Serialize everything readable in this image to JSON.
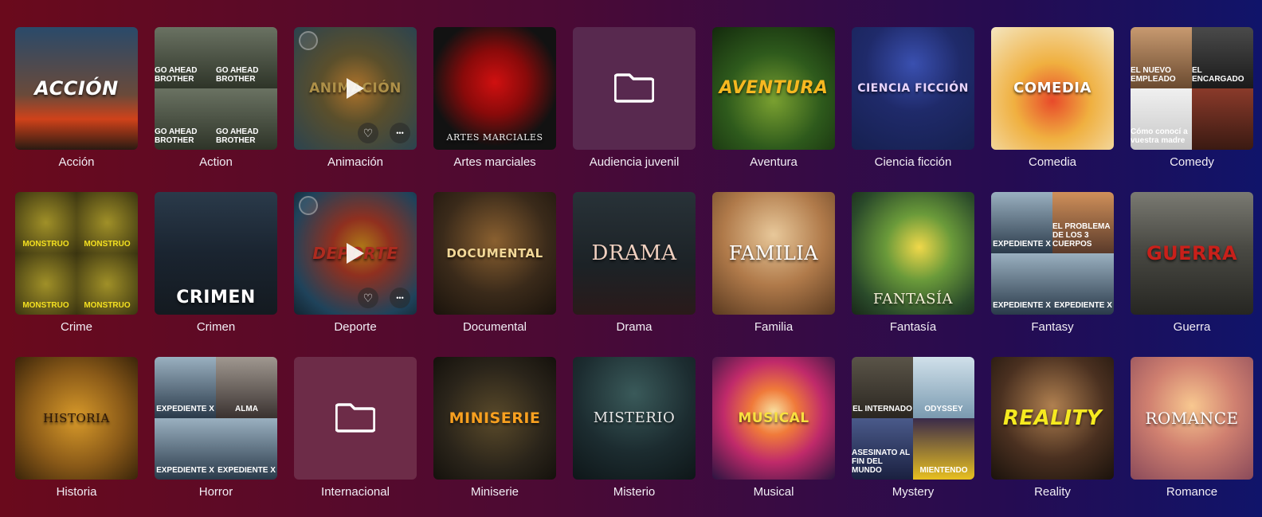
{
  "genres": [
    {
      "label": "Acción",
      "art": "ACCIÓN",
      "style": "accion"
    },
    {
      "label": "Action",
      "art": "",
      "sub": "GO AHEAD BROTHER",
      "style": "action"
    },
    {
      "label": "Animación",
      "art": "ANIMACIÓN",
      "style": "animacion"
    },
    {
      "label": "Artes marciales",
      "art": "ARTES MARCIALES",
      "style": "artes"
    },
    {
      "label": "Audiencia juvenil",
      "art": "",
      "style": "folder"
    },
    {
      "label": "Aventura",
      "art": "AVENTURA",
      "style": "aventura"
    },
    {
      "label": "Ciencia ficción",
      "art": "CIENCIA FICCIÓN",
      "style": "ciencia"
    },
    {
      "label": "Comedia",
      "art": "COMEDIA",
      "style": "comedia"
    },
    {
      "label": "Comedy",
      "art": "",
      "sub": [
        "EL NUEVO EMPLEADO",
        "EL ENCARGADO",
        "Cómo conocí a vuestra madre",
        ""
      ],
      "style": "comedy"
    },
    {
      "label": "Crime",
      "art": "",
      "sub": "MONSTRUO",
      "style": "crime"
    },
    {
      "label": "Crimen",
      "art": "CRIMEN",
      "style": "crimen"
    },
    {
      "label": "Deporte",
      "art": "DEPORTE",
      "style": "deporte"
    },
    {
      "label": "Documental",
      "art": "DOCUMENTAL",
      "style": "documental"
    },
    {
      "label": "Drama",
      "art": "DRAMA",
      "style": "drama"
    },
    {
      "label": "Familia",
      "art": "FAMILIA",
      "style": "familia"
    },
    {
      "label": "Fantasía",
      "art": "FANTASÍA",
      "style": "fantasia"
    },
    {
      "label": "Fantasy",
      "art": "",
      "sub": [
        "EXPEDIENTE X",
        "EL PROBLEMA DE LOS 3 CUERPOS",
        "EXPEDIENTE X",
        "EXPEDIENTE X"
      ],
      "style": "fantasy"
    },
    {
      "label": "Guerra",
      "art": "GUERRA",
      "style": "guerra"
    },
    {
      "label": "Historia",
      "art": "HISTORIA",
      "style": "historia"
    },
    {
      "label": "Horror",
      "art": "",
      "sub": [
        "EXPEDIENTE X",
        "ALMA",
        "EXPEDIENTE X",
        "EXPEDIENTE X"
      ],
      "style": "horror"
    },
    {
      "label": "Internacional",
      "art": "",
      "style": "folder-alt"
    },
    {
      "label": "Miniserie",
      "art": "MINISERIE",
      "style": "miniserie"
    },
    {
      "label": "Misterio",
      "art": "MISTERIO",
      "style": "misterio"
    },
    {
      "label": "Musical",
      "art": "MUSICAL",
      "style": "musical"
    },
    {
      "label": "Mystery",
      "art": "",
      "sub": [
        "EL INTERNADO",
        "ODYSSEY",
        "ASESINATO AL FIN DEL MUNDO",
        "MIENTENDO"
      ],
      "style": "mystery"
    },
    {
      "label": "Reality",
      "art": "REALITY",
      "style": "reality"
    },
    {
      "label": "Romance",
      "art": "ROMANCE",
      "style": "romance"
    }
  ],
  "icons": {
    "folder": "folder-icon",
    "play": "play-icon",
    "heart": "heart-icon",
    "more": "more-icon"
  },
  "hovered": [
    2,
    11
  ]
}
